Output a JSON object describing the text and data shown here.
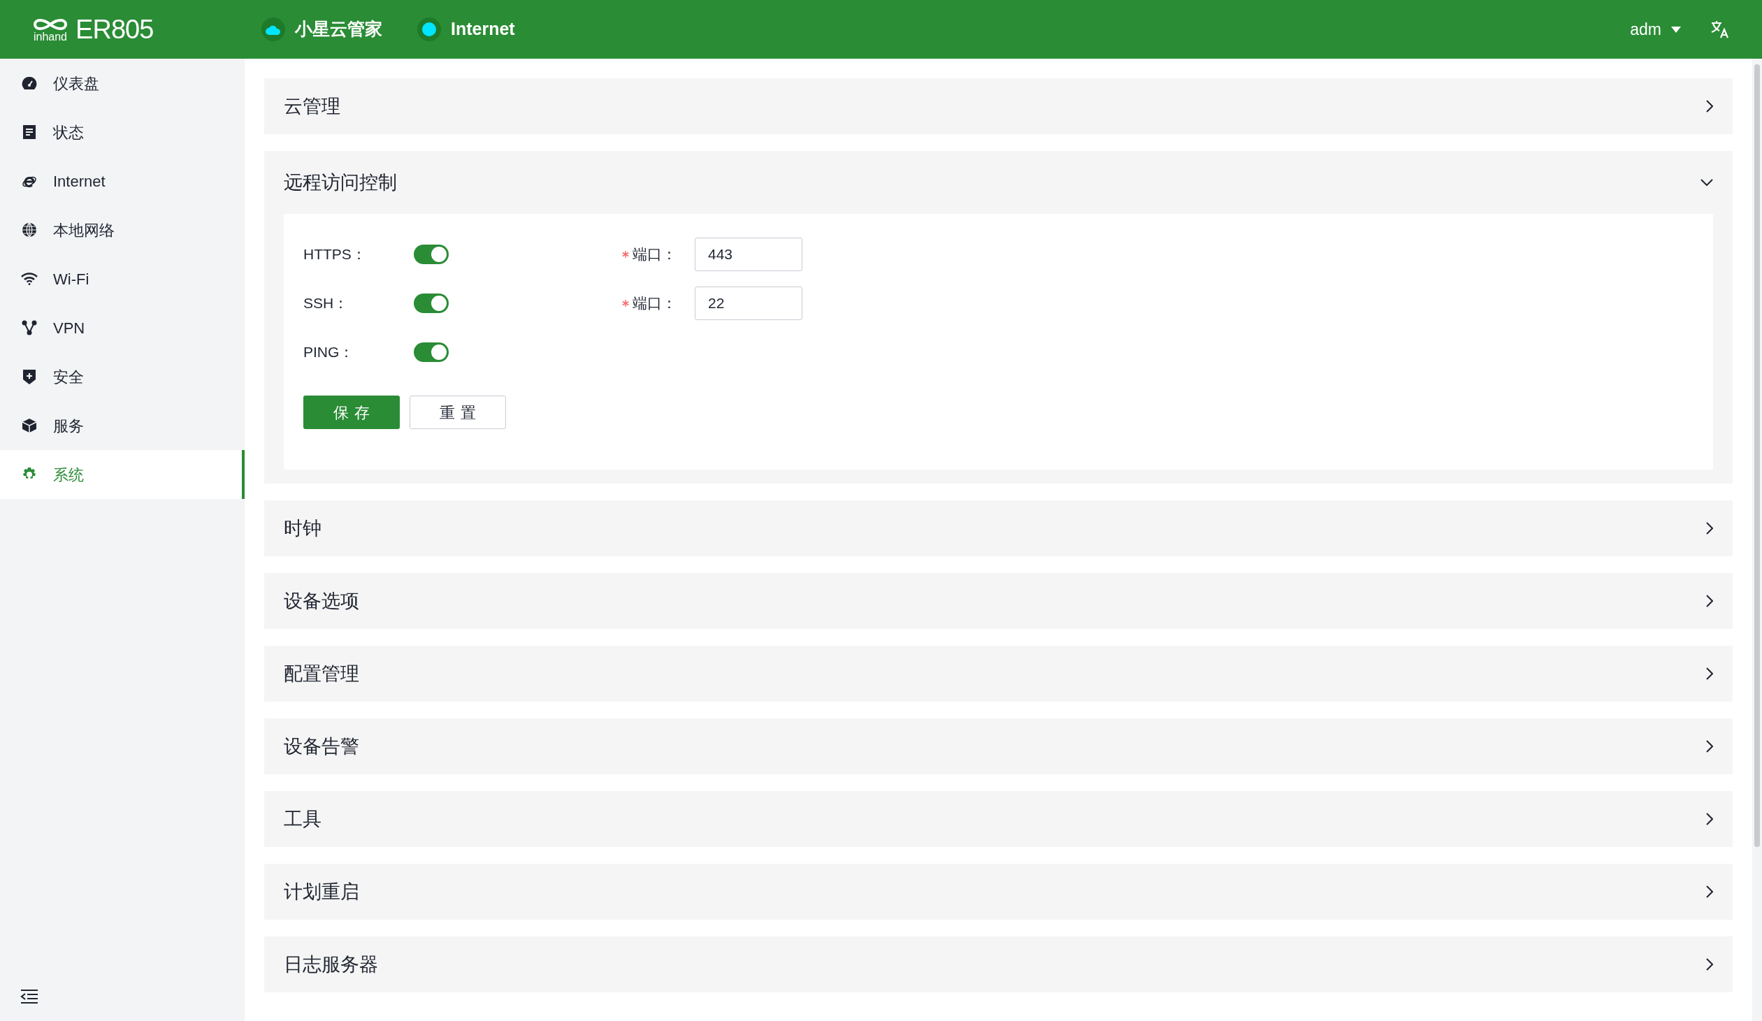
{
  "header": {
    "logo_wordmark": "inhand",
    "product": "ER805",
    "indicators": [
      {
        "kind": "cloud",
        "label": "小星云管家"
      },
      {
        "kind": "dot",
        "label": "Internet"
      }
    ],
    "user": "adm"
  },
  "sidebar": {
    "items": [
      {
        "label": "仪表盘",
        "selected": false
      },
      {
        "label": "状态",
        "selected": false
      },
      {
        "label": "Internet",
        "selected": false
      },
      {
        "label": "本地网络",
        "selected": false
      },
      {
        "label": "Wi-Fi",
        "selected": false
      },
      {
        "label": "VPN",
        "selected": false
      },
      {
        "label": "安全",
        "selected": false
      },
      {
        "label": "服务",
        "selected": false
      },
      {
        "label": "系统",
        "selected": true
      }
    ]
  },
  "panels": [
    {
      "title": "云管理",
      "expanded": false
    },
    {
      "title": "远程访问控制",
      "expanded": true,
      "form": {
        "rows": [
          {
            "label": "HTTPS：",
            "on": true,
            "port": {
              "label": "端口：",
              "required": true,
              "value": "443"
            }
          },
          {
            "label": "SSH：",
            "on": true,
            "port": {
              "label": "端口：",
              "required": true,
              "value": "22"
            }
          },
          {
            "label": "PING：",
            "on": true
          }
        ],
        "buttons": [
          {
            "kind": "primary",
            "label": "保存"
          },
          {
            "kind": "default",
            "label": "重置"
          }
        ]
      }
    },
    {
      "title": "时钟",
      "expanded": false
    },
    {
      "title": "设备选项",
      "expanded": false
    },
    {
      "title": "配置管理",
      "expanded": false
    },
    {
      "title": "设备告警",
      "expanded": false
    },
    {
      "title": "工具",
      "expanded": false
    },
    {
      "title": "计划重启",
      "expanded": false
    },
    {
      "title": "日志服务器",
      "expanded": false
    }
  ]
}
